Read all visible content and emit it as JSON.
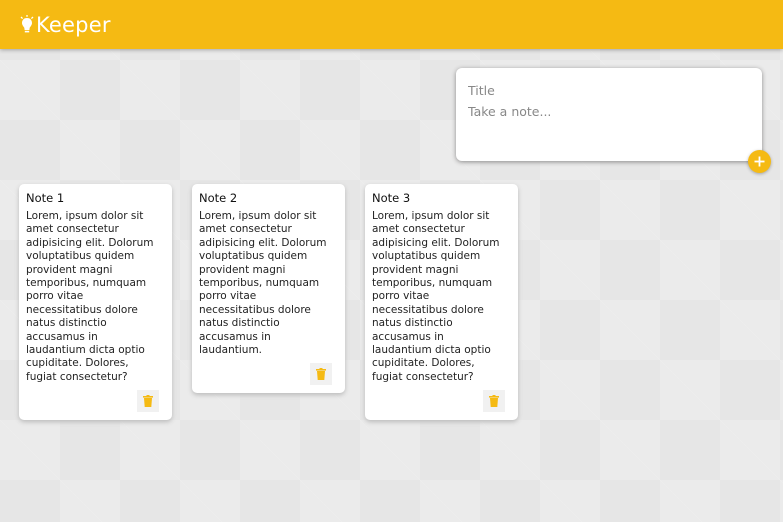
{
  "header": {
    "title": "Keeper",
    "logo_icon": "lightbulb-icon",
    "brand_color": "#f5ba13"
  },
  "create_note": {
    "title_placeholder": "Title",
    "content_placeholder": "Take a note...",
    "add_icon": "plus-icon"
  },
  "notes": [
    {
      "title": "Note 1",
      "content": "Lorem, ipsum dolor sit\namet consectetur\nadipisicing elit. Dolorum\nvoluptatibus quidem\nprovident magni\ntemporibus, numquam\nporro vitae\nnecessitatibus dolore\nnatus distinctio\naccusamus in\nlaudantium dicta optio\ncupiditate. Dolores,\nfugiat consectetur?",
      "delete_icon": "trash-icon"
    },
    {
      "title": "Note 2",
      "content": "Lorem, ipsum dolor sit\namet consectetur\nadipisicing elit. Dolorum\nvoluptatibus quidem\nprovident magni\ntemporibus, numquam\nporro vitae\nnecessitatibus dolore\nnatus distinctio\naccusamus in\nlaudantium.",
      "delete_icon": "trash-icon"
    },
    {
      "title": "Note 3",
      "content": "Lorem, ipsum dolor sit\namet consectetur\nadipisicing elit. Dolorum\nvoluptatibus quidem\nprovident magni\ntemporibus, numquam\nporro vitae\nnecessitatibus dolore\nnatus distinctio\naccusamus in\nlaudantium dicta optio\ncupiditate. Dolores,\nfugiat consectetur?",
      "delete_icon": "trash-icon"
    }
  ]
}
